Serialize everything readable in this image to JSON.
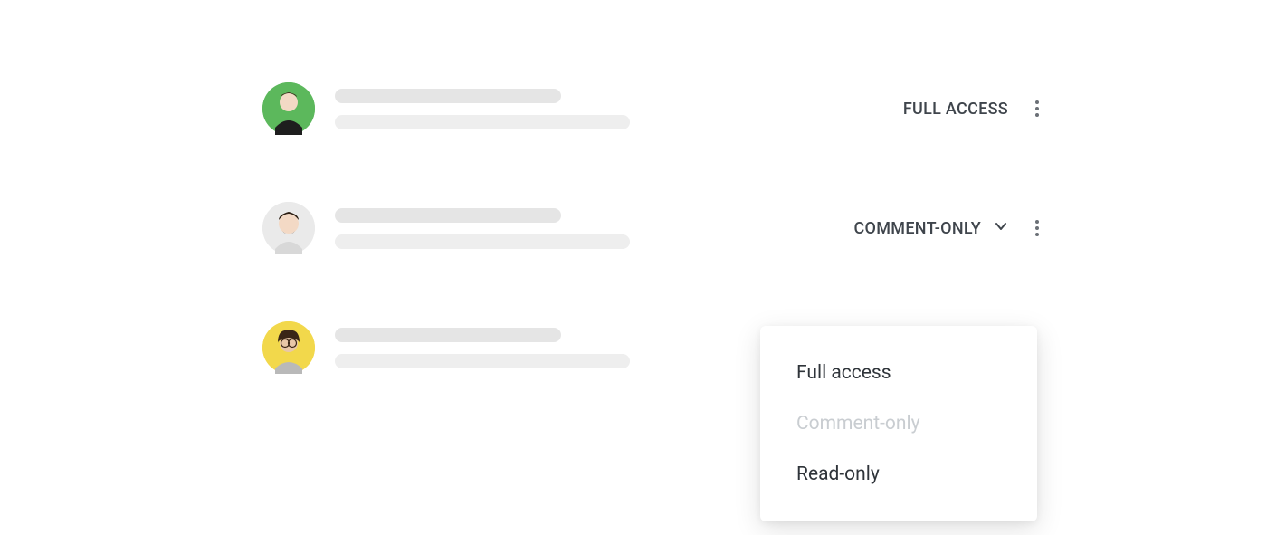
{
  "users": [
    {
      "avatar_bg": "#5cb85c",
      "access": "FULL ACCESS",
      "has_chevron": false
    },
    {
      "avatar_bg": "#e8e8e8",
      "access": "COMMENT-ONLY",
      "has_chevron": true
    },
    {
      "avatar_bg": "#f2d84b",
      "access": "",
      "has_chevron": false
    }
  ],
  "dropdown": {
    "options": {
      "full": "Full access",
      "comment": "Comment-only",
      "read": "Read-only"
    },
    "selected": "Comment-only"
  }
}
